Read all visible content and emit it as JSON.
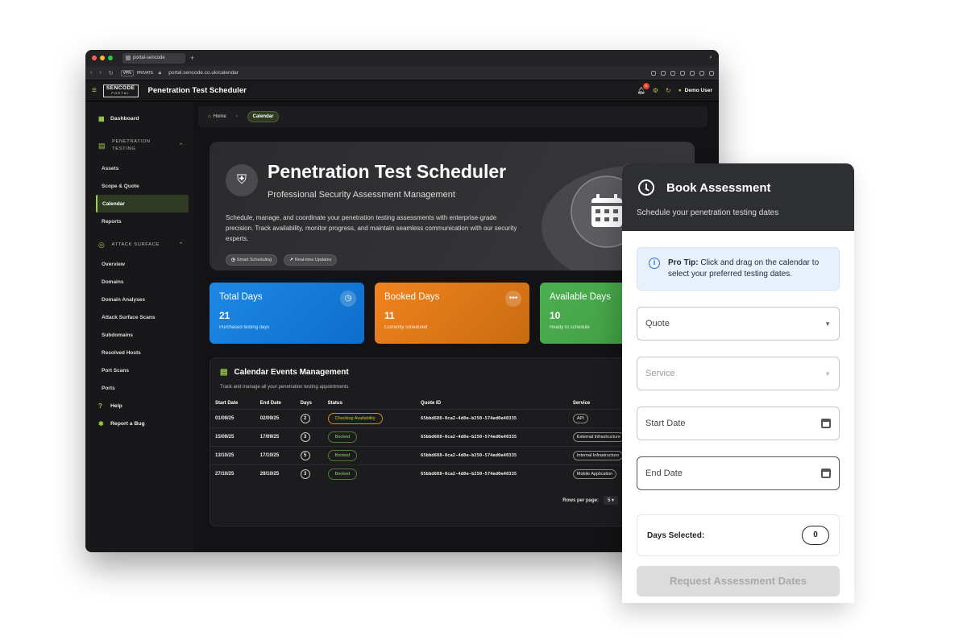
{
  "browser": {
    "tab_title": "portal-sencode",
    "vpn_label": "VPN",
    "private_label": "PRIVATE",
    "url": "portal.sencode.co.uk/calendar"
  },
  "header": {
    "logo_top": "SENCODE",
    "logo_bottom": "PORTAL",
    "title": "Penetration Test Scheduler",
    "notification_count": "0",
    "user": "Demo User"
  },
  "sidebar": {
    "dashboard": "Dashboard",
    "group1": "PENETRATION TESTING",
    "group1_items": [
      "Assets",
      "Scope & Quote",
      "Calendar",
      "Reports"
    ],
    "group2": "ATTACK SURFACE",
    "group2_items": [
      "Overview",
      "Domains",
      "Domain Analyses",
      "Attack Surface Scans",
      "Subdomains",
      "Resolved Hosts",
      "Port Scans",
      "Ports"
    ],
    "help": "Help",
    "bug": "Report a Bug"
  },
  "breadcrumb": {
    "home": "Home",
    "current": "Calendar"
  },
  "hero": {
    "title": "Penetration Test Scheduler",
    "subtitle": "Professional Security Assessment Management",
    "description": "Schedule, manage, and coordinate your penetration testing assessments with enterprise-grade precision. Track availability, monitor progress, and maintain seamless communication with our security experts.",
    "chip1": "Smart Scheduling",
    "chip2": "Real-time Updates"
  },
  "stats": [
    {
      "label": "Total Days",
      "value": "21",
      "caption": "Purchased testing days"
    },
    {
      "label": "Booked Days",
      "value": "11",
      "caption": "Currently scheduled"
    },
    {
      "label": "Available Days",
      "value": "10",
      "caption": "Ready to schedule"
    }
  ],
  "events": {
    "title": "Calendar Events Management",
    "description": "Track and manage all your penetration testing appointments",
    "columns": [
      "Start Date",
      "End Date",
      "Days",
      "Status",
      "Quote ID",
      "Service"
    ],
    "rows": [
      {
        "start": "01/09/25",
        "end": "02/09/25",
        "days": "2",
        "status": "Checking Availability",
        "quote": "65bbd688-0ca2-4d8e-b250-574ed0e40335",
        "service": "API"
      },
      {
        "start": "15/09/25",
        "end": "17/09/25",
        "days": "3",
        "status": "Booked",
        "quote": "65bbd688-0ca2-4d8e-b250-574ed0e40335",
        "service": "External Infrastructure"
      },
      {
        "start": "13/10/25",
        "end": "17/10/25",
        "days": "5",
        "status": "Booked",
        "quote": "65bbd688-0ca2-4d8e-b250-574ed0e40335",
        "service": "Internal Infrastructure"
      },
      {
        "start": "27/10/25",
        "end": "29/10/25",
        "days": "3",
        "status": "Booked",
        "quote": "65bbd688-0ca2-4d8e-b250-574ed0e40335",
        "service": "Mobile Application"
      }
    ],
    "rows_per_page_label": "Rows per page:",
    "rows_per_page_value": "5"
  },
  "book": {
    "title": "Book Assessment",
    "subtitle": "Schedule your penetration testing dates",
    "tip_bold": "Pro Tip:",
    "tip_text": " Click and drag on the calendar to select your preferred testing dates.",
    "quote_placeholder": "Quote",
    "service_placeholder": "Service",
    "start_placeholder": "Start Date",
    "end_placeholder": "End Date",
    "days_label": "Days Selected:",
    "days_value": "0",
    "button": "Request Assessment Dates"
  }
}
